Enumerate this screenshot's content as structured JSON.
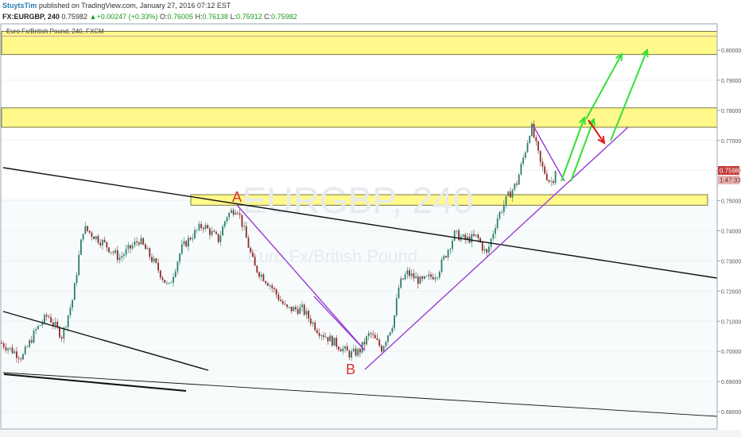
{
  "header": {
    "author": "StuytsTim",
    "published_text": "published on TradingView.com, January 27, 2016 07:12 EST",
    "symbol": "FX:EURGBP, 240",
    "open_label": "O:",
    "open": "0.76005",
    "high_label": "H:",
    "high": "0.76138",
    "low_label": "L:",
    "low": "0.75912",
    "close_label": "C:",
    "close": "0.75982",
    "last": "0.75982",
    "change": "+0.00247 (+0.33%)"
  },
  "instrument_label": "Euro Fx/British Pound, 240, FXCM",
  "watermark": {
    "symbol": "EURGBP, 240",
    "description": "Euro Fx/British Pound"
  },
  "price_tag": {
    "price": "0.75982",
    "countdown": "1:47:33"
  },
  "annotations": {
    "point_a": "A",
    "point_b": "B"
  },
  "colors": {
    "zone_fill": "#fff88a",
    "zone_border": "#5a5a20",
    "pattern_line": "#9a3cd6",
    "projection_up": "#33e033",
    "projection_down": "#e01a1a",
    "trend_line": "#111111",
    "candle_up": "#2d7d6a",
    "candle_down": "#8a2b2b",
    "price_tag": "#c43a3a"
  },
  "chart_data": {
    "type": "candlestick",
    "symbol": "EURGBP",
    "timeframe": "240",
    "y_axis_ticks": [
      "0.68000",
      "0.69000",
      "0.70000",
      "0.71000",
      "0.72000",
      "0.73000",
      "0.74000",
      "0.75000",
      "0.76000",
      "0.77000",
      "0.78000",
      "0.79000",
      "0.80000"
    ],
    "ylim": [
      0.6772,
      0.8075
    ],
    "last_close": 0.75982,
    "price_path": [
      [
        0,
        0.703
      ],
      [
        28,
        0.698
      ],
      [
        45,
        0.707
      ],
      [
        60,
        0.712
      ],
      [
        78,
        0.705
      ],
      [
        92,
        0.718
      ],
      [
        100,
        0.733
      ],
      [
        105,
        0.741
      ],
      [
        130,
        0.736
      ],
      [
        150,
        0.731
      ],
      [
        175,
        0.737
      ],
      [
        195,
        0.729
      ],
      [
        212,
        0.721
      ],
      [
        228,
        0.734
      ],
      [
        240,
        0.738
      ],
      [
        255,
        0.742
      ],
      [
        275,
        0.737
      ],
      [
        285,
        0.745
      ],
      [
        298,
        0.748
      ],
      [
        306,
        0.741
      ],
      [
        320,
        0.728
      ],
      [
        340,
        0.722
      ],
      [
        360,
        0.714
      ],
      [
        380,
        0.714
      ],
      [
        400,
        0.707
      ],
      [
        420,
        0.703
      ],
      [
        440,
        0.699
      ],
      [
        452,
        0.7
      ],
      [
        465,
        0.706
      ],
      [
        480,
        0.701
      ],
      [
        495,
        0.71
      ],
      [
        502,
        0.722
      ],
      [
        512,
        0.726
      ],
      [
        530,
        0.723
      ],
      [
        550,
        0.726
      ],
      [
        562,
        0.733
      ],
      [
        572,
        0.739
      ],
      [
        585,
        0.737
      ],
      [
        600,
        0.738
      ],
      [
        612,
        0.732
      ],
      [
        625,
        0.744
      ],
      [
        638,
        0.751
      ],
      [
        650,
        0.756
      ],
      [
        660,
        0.766
      ],
      [
        668,
        0.775
      ],
      [
        680,
        0.762
      ],
      [
        692,
        0.756
      ],
      [
        700,
        0.759
      ]
    ],
    "zones": [
      {
        "from": 0.7985,
        "to": 0.8062
      },
      {
        "from": 0.7744,
        "to": 0.7808
      },
      {
        "from": 0.7485,
        "to": 0.752
      }
    ]
  }
}
